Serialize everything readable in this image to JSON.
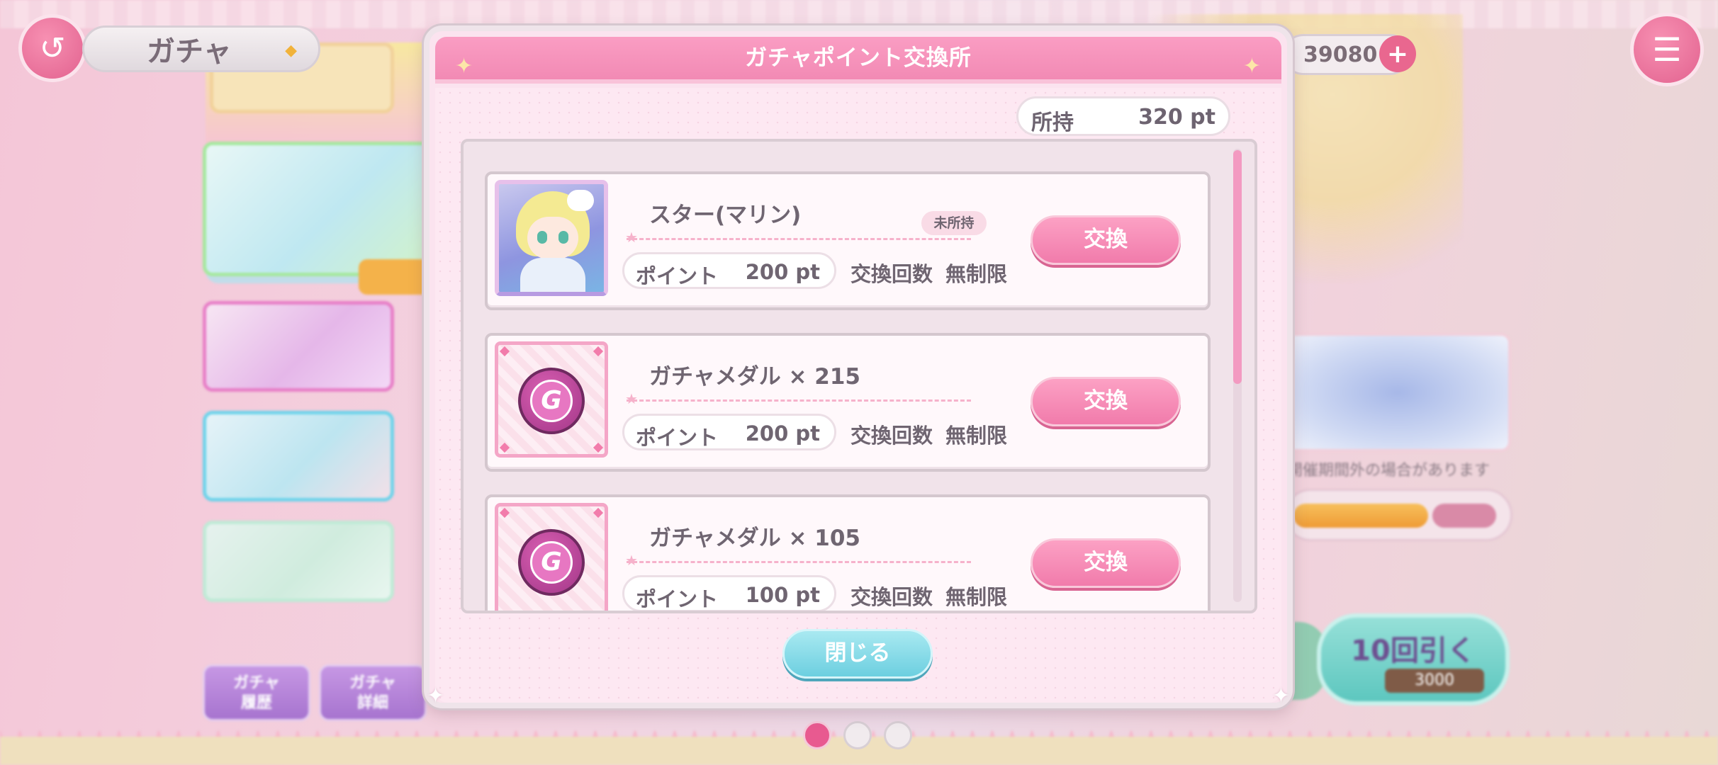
{
  "background": {
    "screen_title": "ガチャ",
    "coin_balance": "39080",
    "history_button": "ガチャ\n履歴",
    "detail_button": "ガチャ\n詳細",
    "ten_pull_label": "10回引く",
    "ten_pull_cost": "3000",
    "event_note": "開催期間外の場合があります",
    "page_dots": 3,
    "active_page": 0
  },
  "modal": {
    "title": "ガチャポイント交換所",
    "owned_label": "所持",
    "owned_value": "320 pt",
    "close_label": "閉じる",
    "items": [
      {
        "name": "スター(マリン)",
        "thumb": "character-portrait",
        "badge": "未所持",
        "points_label": "ポイント",
        "points_value": "200 pt",
        "count_label": "交換回数",
        "count_value": "無制限",
        "button": "交換"
      },
      {
        "name": "ガチャメダル × 215",
        "thumb": "gacha-medal-icon",
        "badge": "",
        "points_label": "ポイント",
        "points_value": "200 pt",
        "count_label": "交換回数",
        "count_value": "無制限",
        "button": "交換"
      },
      {
        "name": "ガチャメダル × 105",
        "thumb": "gacha-medal-icon",
        "badge": "",
        "points_label": "ポイント",
        "points_value": "100 pt",
        "count_label": "交換回数",
        "count_value": "無制限",
        "button": "交換"
      }
    ]
  },
  "colors": {
    "header_pink": "#f28ab4",
    "button_pink": "#f17bab",
    "close_cyan": "#6ccfe0",
    "text": "#6f6571"
  }
}
